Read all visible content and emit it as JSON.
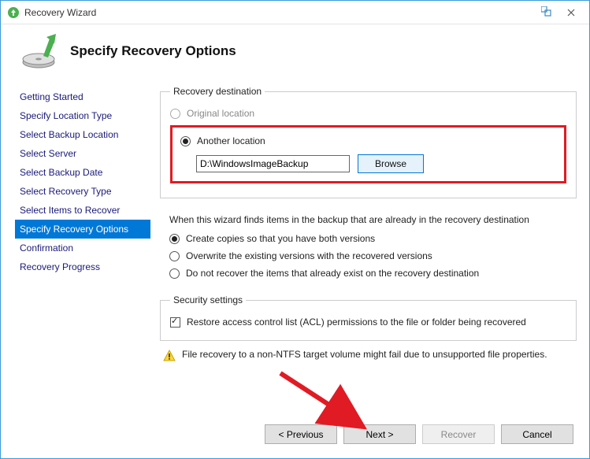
{
  "titlebar": {
    "title": "Recovery Wizard"
  },
  "header": {
    "title": "Specify Recovery Options"
  },
  "sidebar": {
    "items": [
      {
        "label": "Getting Started"
      },
      {
        "label": "Specify Location Type"
      },
      {
        "label": "Select Backup Location"
      },
      {
        "label": "Select Server"
      },
      {
        "label": "Select Backup Date"
      },
      {
        "label": "Select Recovery Type"
      },
      {
        "label": "Select Items to Recover"
      },
      {
        "label": "Specify Recovery Options"
      },
      {
        "label": "Confirmation"
      },
      {
        "label": "Recovery Progress"
      }
    ],
    "active_index": 7
  },
  "destination": {
    "legend": "Recovery destination",
    "original_label": "Original location",
    "another_label": "Another location",
    "path_value": "D:\\WindowsImageBackup",
    "browse_label": "Browse"
  },
  "conflict": {
    "heading": "When this wizard finds items in the backup that are already in the recovery destination",
    "opt_copies": "Create copies so that you have both versions",
    "opt_overwrite": "Overwrite the existing versions with the recovered versions",
    "opt_skip": "Do not recover the items that already exist on the recovery destination"
  },
  "security": {
    "legend": "Security settings",
    "acl_label": "Restore access control list (ACL) permissions to the file or folder being recovered"
  },
  "warning": {
    "text": "File recovery to a non-NTFS target volume might fail due to unsupported file properties."
  },
  "footer": {
    "previous": "< Previous",
    "next": "Next >",
    "recover": "Recover",
    "cancel": "Cancel"
  }
}
